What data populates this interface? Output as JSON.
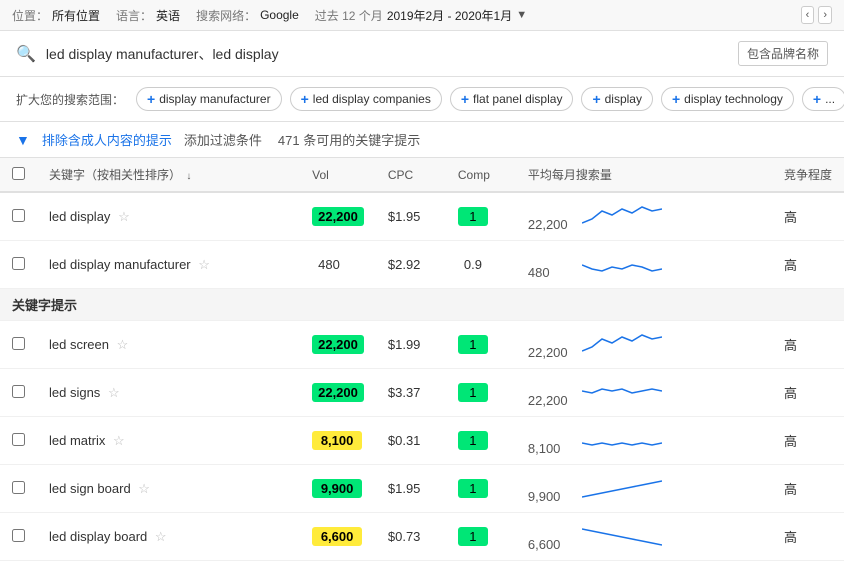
{
  "topbar": {
    "location_label": "位置：",
    "location_value": "所有位置",
    "language_label": "语言：",
    "language_value": "英语",
    "network_label": "搜索网络：",
    "network_value": "Google",
    "period_label": "过去 12 个月",
    "date_range": "2019年2月 - 2020年1月"
  },
  "search": {
    "query": "led display manufacturer、led display",
    "brand_tag": "包含品牌名称",
    "search_icon": "🔍"
  },
  "expand": {
    "label": "扩大您的搜索范围：",
    "chips": [
      "display manufacturer",
      "led display companies",
      "flat panel display",
      "display",
      "display technology"
    ],
    "more": "+"
  },
  "filter": {
    "icon": "▼",
    "exclude_link": "排除含成人内容的提示",
    "add_filter": "添加过滤条件",
    "count_text": "471 条可用的关键字提示"
  },
  "table": {
    "headers": {
      "checkbox": "",
      "keyword": "关键字（按相关性排序）",
      "sort_arrow": "↓",
      "vol": "Vol",
      "cpc": "CPC",
      "comp": "Comp",
      "trend": "平均每月搜索量",
      "compete": "竞争程度"
    },
    "rows": [
      {
        "id": "led-display",
        "keyword": "led display",
        "star": "☆",
        "vol": "22,200",
        "vol_type": "green",
        "cpc": "$1.95",
        "comp": "1",
        "comp_type": "green",
        "trend_vol": "22,200",
        "compete": "高",
        "sparkline": "high"
      },
      {
        "id": "led-display-manufacturer",
        "keyword": "led display manufacturer",
        "star": "☆",
        "vol": "480",
        "vol_type": "plain",
        "cpc": "$2.92",
        "comp": "0.9",
        "comp_type": "plain",
        "trend_vol": "480",
        "compete": "高",
        "sparkline": "medium"
      }
    ],
    "section_header": "关键字提示",
    "suggestion_rows": [
      {
        "id": "led-screen",
        "keyword": "led screen",
        "star": "☆",
        "vol": "22,200",
        "vol_type": "green",
        "cpc": "$1.99",
        "comp": "1",
        "comp_type": "green",
        "trend_vol": "22,200",
        "compete": "高",
        "sparkline": "high"
      },
      {
        "id": "led-signs",
        "keyword": "led signs",
        "star": "☆",
        "vol": "22,200",
        "vol_type": "green",
        "cpc": "$3.37",
        "comp": "1",
        "comp_type": "green",
        "trend_vol": "22,200",
        "compete": "高",
        "sparkline": "flat"
      },
      {
        "id": "led-matrix",
        "keyword": "led matrix",
        "star": "☆",
        "vol": "8,100",
        "vol_type": "yellow",
        "cpc": "$0.31",
        "comp": "1",
        "comp_type": "green",
        "trend_vol": "8,100",
        "compete": "高",
        "sparkline": "low-flat"
      },
      {
        "id": "led-sign-board",
        "keyword": "led sign board",
        "star": "☆",
        "vol": "9,900",
        "vol_type": "green",
        "cpc": "$1.95",
        "comp": "1",
        "comp_type": "green",
        "trend_vol": "9,900",
        "compete": "高",
        "sparkline": "rising"
      },
      {
        "id": "led-display-board",
        "keyword": "led display board",
        "star": "☆",
        "vol": "6,600",
        "vol_type": "yellow",
        "cpc": "$0.73",
        "comp": "1",
        "comp_type": "green",
        "trend_vol": "6,600",
        "compete": "高",
        "sparkline": "falling"
      }
    ]
  }
}
